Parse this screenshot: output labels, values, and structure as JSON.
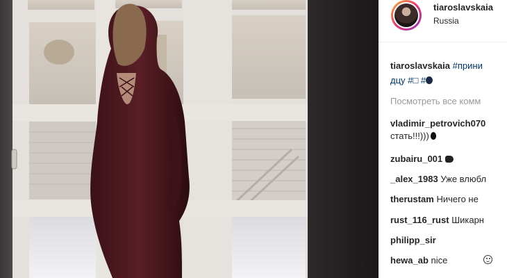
{
  "post": {
    "username": "tiaroslavskaia",
    "location": "Russia",
    "caption": {
      "username": "tiaroslavskaia",
      "line1_tag": "#прини",
      "line2": "дцу",
      "tag2": "#□",
      "tag3": "#"
    },
    "view_all": "Посмотреть все комм"
  },
  "comments": [
    {
      "user": "vladimir_petrovich070",
      "text": "",
      "cont": "стать!!!)))"
    },
    {
      "user": "zubairu_001",
      "text": ""
    },
    {
      "user": "_alex_1983",
      "text": "Уже влюбл"
    },
    {
      "user": "therustam",
      "text": "Ничего не"
    },
    {
      "user": "rust_116_rust",
      "text": "Шикарн"
    },
    {
      "user": "philipp_sir",
      "text": ""
    },
    {
      "user": "hewa_ab",
      "text": "nice"
    }
  ],
  "icons": {
    "avatar": "profile-picture",
    "comment2_emoji": "dark-fruit-emoji",
    "comment3_emoji": "pointing-hand-emoji",
    "comment8_emoji": "smiley-face-emoji"
  },
  "colors": {
    "dress": "#5a1e26",
    "link": "#003569",
    "muted": "#999999",
    "text": "#262626"
  }
}
